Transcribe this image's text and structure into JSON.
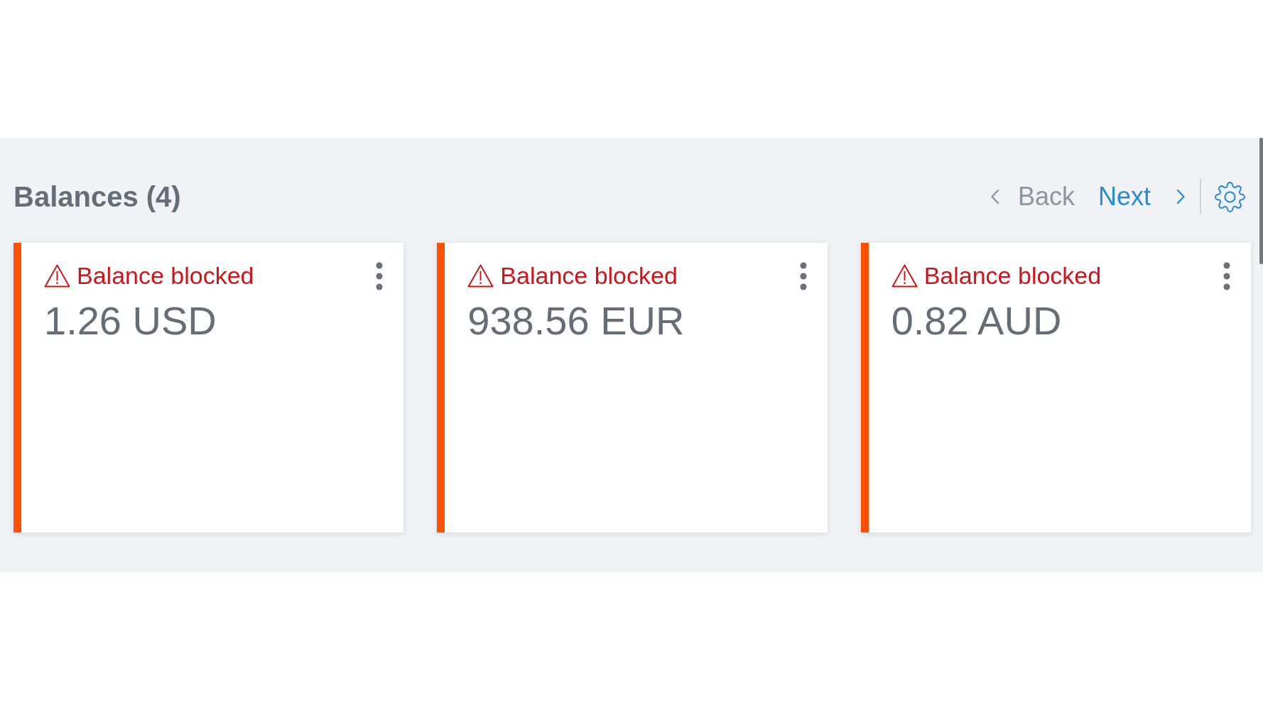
{
  "section": {
    "title": "Balances (4)"
  },
  "pager": {
    "back": {
      "label": "Back",
      "disabled": true
    },
    "next": {
      "label": "Next",
      "disabled": false
    }
  },
  "balances": [
    {
      "status": "Balance blocked",
      "amount": "1.26 USD",
      "blocked": true
    },
    {
      "status": "Balance blocked",
      "amount": "938.56 EUR",
      "blocked": true
    },
    {
      "status": "Balance blocked",
      "amount": "0.82 AUD",
      "blocked": true
    }
  ]
}
